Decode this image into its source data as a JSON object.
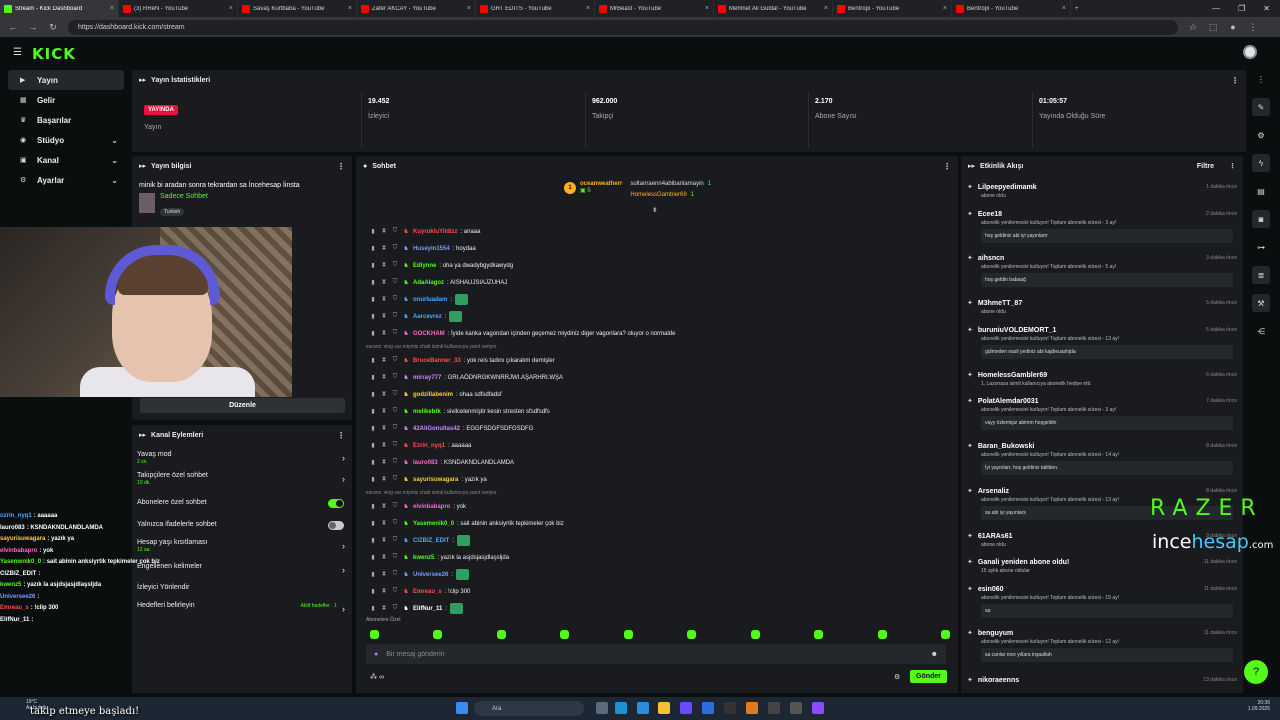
{
  "browser": {
    "tabs": [
      {
        "label": "Stream - Kick Dashboard",
        "active": true,
        "kind": "kick"
      },
      {
        "label": "(3) RReN - YouTube",
        "kind": "yt"
      },
      {
        "label": "Savaş Kurtbaba - YouTube",
        "kind": "yt"
      },
      {
        "label": "Zafer AKCAY - YouTube",
        "kind": "yt"
      },
      {
        "label": "GRT EDİTS - YouTube",
        "kind": "yt"
      },
      {
        "label": "MrBeast - YouTube",
        "kind": "yt"
      },
      {
        "label": "Mehmet Ali Güldal - YouTube",
        "kind": "yt"
      },
      {
        "label": "Bentropi - YouTube",
        "kind": "yt"
      },
      {
        "label": "Bentropi - YouTube",
        "kind": "yt"
      }
    ],
    "url": "https://dashboard.kick.com/stream"
  },
  "brand": {
    "logo": "KICK",
    "accent": "#53fc18",
    "live_red": "#e9113c"
  },
  "sidebar": {
    "items": [
      {
        "label": "Yayın",
        "icon": "broadcast-icon",
        "active": true
      },
      {
        "label": "Gelir",
        "icon": "money-icon"
      },
      {
        "label": "Başarılar",
        "icon": "trophy-icon"
      },
      {
        "label": "Stüdyo",
        "icon": "studio-icon",
        "expand": true
      },
      {
        "label": "Kanal",
        "icon": "channel-icon",
        "expand": true
      },
      {
        "label": "Ayarlar",
        "icon": "gear-icon",
        "expand": true
      }
    ]
  },
  "stats": {
    "title": "Yayın İstatistikleri",
    "cells": [
      {
        "value": "YAYINDA",
        "label": "Yayın",
        "badge": true
      },
      {
        "value": "19.452",
        "label": "İzleyici"
      },
      {
        "value": "962.000",
        "label": "Takipçi"
      },
      {
        "value": "2.170",
        "label": "Abone Sayısı"
      },
      {
        "value": "01:05:57",
        "label": "Yayında Olduğu Süre"
      }
    ]
  },
  "stream_info": {
    "header": "Yayın bilgisi",
    "title": "minik bi aradan sonra tekrardan sa İncehesap İinsta",
    "category": "Sadece Sohbet",
    "language": "Turkish",
    "edit_label": "Düzenle"
  },
  "channel_actions": {
    "header": "Kanal Eylemleri",
    "rows": [
      {
        "label": "Yavaş mod",
        "sub": "2 sn.",
        "control": "chevron"
      },
      {
        "label": "Takipçilere özel sohbet",
        "sub": "10 dk.",
        "control": "chevron"
      },
      {
        "label": "Abonelere özel sohbet",
        "sub": "",
        "control": "toggle-on"
      },
      {
        "label": "Yalnızca ifadelerle sohbet",
        "sub": "",
        "control": "toggle-off"
      },
      {
        "label": "Hesap yaşı kısıtlaması",
        "sub": "12 sa.",
        "control": "chevron"
      },
      {
        "label": "Engellenen kelimeler",
        "sub": "",
        "control": "chevron"
      },
      {
        "label": "İzleyici Yönlendir",
        "sub": "",
        "control": "none"
      },
      {
        "label": "Hedefleri belirleyin",
        "sub": "",
        "control": "chevron",
        "aside": "Aktif hedefler · 1"
      }
    ]
  },
  "overlay_chat": [
    {
      "user": "ozrin_nyq1",
      "text": ": aaaaaa",
      "color": "#4aa8ff"
    },
    {
      "user": "lauro083",
      "text": ": KSNDAKNDLANDLAMDA",
      "color": "#ffffff"
    },
    {
      "user": "sayurisuwagara",
      "text": ": yazık ya",
      "color": "#ffcc33"
    },
    {
      "user": "elvinbabapro",
      "text": ": yok",
      "color": "#ff66cc"
    },
    {
      "user": "Yasemenik0_0",
      "text": ": sait abinin anksiyrtik tepkimeler çok biz",
      "color": "#53fc18"
    },
    {
      "user": "CIZBIZ_EDIT",
      "text": ":",
      "color": "#ffffff"
    },
    {
      "user": "kwenz5",
      "text": ": yazık la asjdsjasjdlaşsljda",
      "color": "#53fc18"
    },
    {
      "user": "Universee26",
      "text": ":",
      "color": "#7a9cff"
    },
    {
      "user": "Emreau_s",
      "text": ": !clip 300",
      "color": "#ff4d4d"
    },
    {
      "user": "ElifNur_11",
      "text": ":",
      "color": "#ffffff"
    }
  ],
  "chat": {
    "header": "Sohbet",
    "pinned": {
      "rank": "1",
      "top_user": "oceanweatherr",
      "top_count": "5",
      "users": [
        {
          "name": "sultanraenn4abibanlamayin",
          "count": "1"
        },
        {
          "name": "HomelessGambler69",
          "count": "1"
        }
      ]
    },
    "messages": [
      {
        "user": "KuyrukluYildizz",
        "text": ": anaaa",
        "color": "#ff4d4d"
      },
      {
        "user": "Huseyin1554",
        "text": ": hoydaa",
        "color": "#7a9cff"
      },
      {
        "user": "Edlynne",
        "text": ": oha ya dwadybgydkawydg",
        "color": "#53fc18"
      },
      {
        "user": "AdaAlagoz",
        "text": ": AISHAUJSIAJZUHAJ",
        "color": "#53fc18"
      },
      {
        "user": "onurluadam",
        "text": ":",
        "color": "#4aa8ff",
        "emote": true
      },
      {
        "user": "Aarcevrez",
        "text": ":",
        "color": "#4aa8ff",
        "emote": true
      },
      {
        "user": "GOCKHAM",
        "text": ": İyide kanka vagondan içinden geçemez miydiniz diger vagonlara? oluyor o normalde",
        "color": "#ff66cc"
      },
      {
        "reply": "esranz: vlog var miymis chatt isimli kullanıcıya yanıt veriyor"
      },
      {
        "user": "BruceBanner_33",
        "text": ": yok reis tadını çıkaralım demişler",
        "color": "#ff4d4d"
      },
      {
        "user": "mirray777",
        "text": ": GRI.AÖDNRGKWNRRJWI.AŞARHRI.WŞA",
        "color": "#cc88ff"
      },
      {
        "user": "godzillabenim",
        "text": ": ohaa sdfsdfadsf",
        "color": "#ffcc33"
      },
      {
        "user": "melikebtk",
        "text": ": sivilcelenmiştir kesin stresten sfsdfsdfs",
        "color": "#53fc18"
      },
      {
        "user": "42AliGonultas42",
        "text": ": EGGFSDGFSDFGSDFG",
        "color": "#cc88ff"
      },
      {
        "user": "Ezrin_nyq1",
        "text": ": aaaaaa",
        "color": "#ff4d4d"
      },
      {
        "user": "lauro083",
        "text": ": KSNDAKNDLANDLAMDA",
        "color": "#ff66cc"
      },
      {
        "user": "sayurisuwagara",
        "text": ": yazık ya",
        "color": "#ffcc33"
      },
      {
        "reply": "esranz: vlog var miymis chatt isimli kullanıcıya yanıt veriyor"
      },
      {
        "user": "elvinbabapro",
        "text": ": yok",
        "color": "#ff66cc"
      },
      {
        "user": "Yasemenik0_0",
        "text": ": sait abinin anksiyrtik tepkimeler çok biz",
        "color": "#53fc18"
      },
      {
        "user": "CIZBIZ_EDIT",
        "text": ":",
        "color": "#4aa8ff",
        "emote": true
      },
      {
        "user": "kwenz5",
        "text": ": yazık la asjdsjasjdlaşsljda",
        "color": "#53fc18"
      },
      {
        "user": "Universee26",
        "text": ":",
        "color": "#7a9cff",
        "emote": true
      },
      {
        "user": "Emreau_s",
        "text": ": !clip 300",
        "color": "#ff4d4d"
      },
      {
        "user": "ElifNur_11",
        "text": ":",
        "color": "#ffffff",
        "emote": true
      }
    ],
    "mode_label": "Abonelere Özel",
    "input_placeholder": "Bir mesaj gönderin",
    "send_label": "Gönder"
  },
  "activity": {
    "header": "Etkinlik Akışı",
    "filter_label": "Filtre",
    "events": [
      {
        "user": "Lilpeepyedimamk",
        "time": "1 dakika önce",
        "desc": "abone oldu",
        "box": ""
      },
      {
        "user": "Ecee18",
        "time": "2 dakika önce",
        "desc": "abonelik yenilemesini kutluyor! Toplam abonelik süresi - 3 ay!",
        "box": "hoş geldiniz abi iyi yayınlarrr"
      },
      {
        "user": "aihsncn",
        "time": "3 dakika önce",
        "desc": "abonelik yenilemesini kutluyor! Toplam abonelik süresi - 5 ay!",
        "box": "hoş geldin babaağ"
      },
      {
        "user": "M3hmeTT_87",
        "time": "5 dakika önce",
        "desc": "abone oldu",
        "box": ""
      },
      {
        "user": "buruniuVOLDEMORT_1",
        "time": "5 dakika önce",
        "desc": "abonelik yenilemesini kutluyor! Toplam abonelik süresi - 13 ay!",
        "box": "gülmeden nasil yediniz abi kajdieuashjda"
      },
      {
        "user": "HomelessGambler69",
        "time": "6 dakika önce",
        "desc": "1, Lazonasa isimli kullanıcıya abonelik hediye etti.",
        "box": ""
      },
      {
        "user": "PolatAlemdar0031",
        "time": "7 dakika önce",
        "desc": "abonelik yenilemesini kutluyor! Toplam abonelik süresi - 3 ay!",
        "box": "vayy özlemişiz abimm hoşgeldin"
      },
      {
        "user": "Baran_Bukowski",
        "time": "8 dakika önce",
        "desc": "abonelik yenilemesini kutluyor! Toplam abonelik süresi - 14 ay!",
        "box": "İyi yayınlarr, hoş geldiniz tatilden."
      },
      {
        "user": "Arsenaliz",
        "time": "8 dakika önce",
        "desc": "abonelik yenilemesini kutluyor! Toplam abonelik süresi - 13 ay!",
        "box": "sa abi iyi yayınlars"
      },
      {
        "user": "61ARAs61",
        "time": "9 dakika önce",
        "desc": "abone oldu",
        "box": ""
      },
      {
        "user": "Ganali yeniden abone oldu!",
        "time": "11 dakika önce",
        "desc": "15 aylık abone oldular",
        "box": ""
      },
      {
        "user": "esin060",
        "time": "11 dakika önce",
        "desc": "abonelik yenilemesini kutluyor! Toplam abonelik süresi - 15 ay!",
        "box": "sa"
      },
      {
        "user": "benguyum",
        "time": "11 dakika önce",
        "desc": "abonelik yenilemesini kutluyor! Toplam abonelik süresi - 12 ay!",
        "box": "sa canlar nice yıllara inşaallah"
      },
      {
        "user": "nikoraeenns",
        "time": "13 dakika önce",
        "desc": "",
        "box": ""
      }
    ]
  },
  "watermark": {
    "razer": "RAZER",
    "ince": "ince",
    "hesap": "hesap",
    "com": ".com"
  },
  "taskbar": {
    "weather": "19°C",
    "weather_sub": "Az bulutlu",
    "search": "Ara",
    "time": "20:36",
    "date": "1.09.2025"
  },
  "caption": "takip etmeye başladı!"
}
